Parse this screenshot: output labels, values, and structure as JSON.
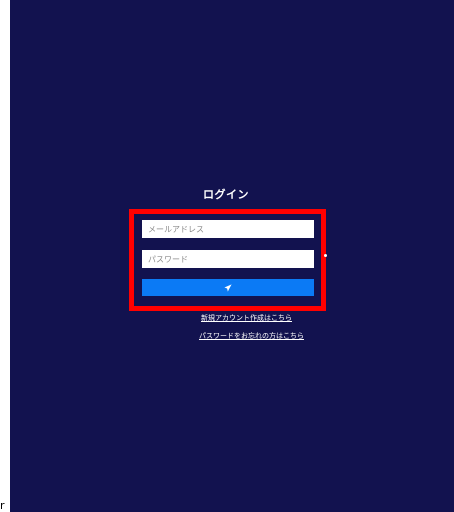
{
  "login": {
    "title": "ログイン",
    "email_placeholder": "メールアドレス",
    "password_placeholder": "パスワード",
    "submit_icon": "send-icon"
  },
  "links": {
    "register": "新規アカウント作成はこちら",
    "forgot_password": "パスワードをお忘れの方はこちら"
  },
  "colors": {
    "page_background": "#12124f",
    "highlight_frame": "#ff0000",
    "submit_button": "#0b7af5"
  },
  "corner_text": "r"
}
